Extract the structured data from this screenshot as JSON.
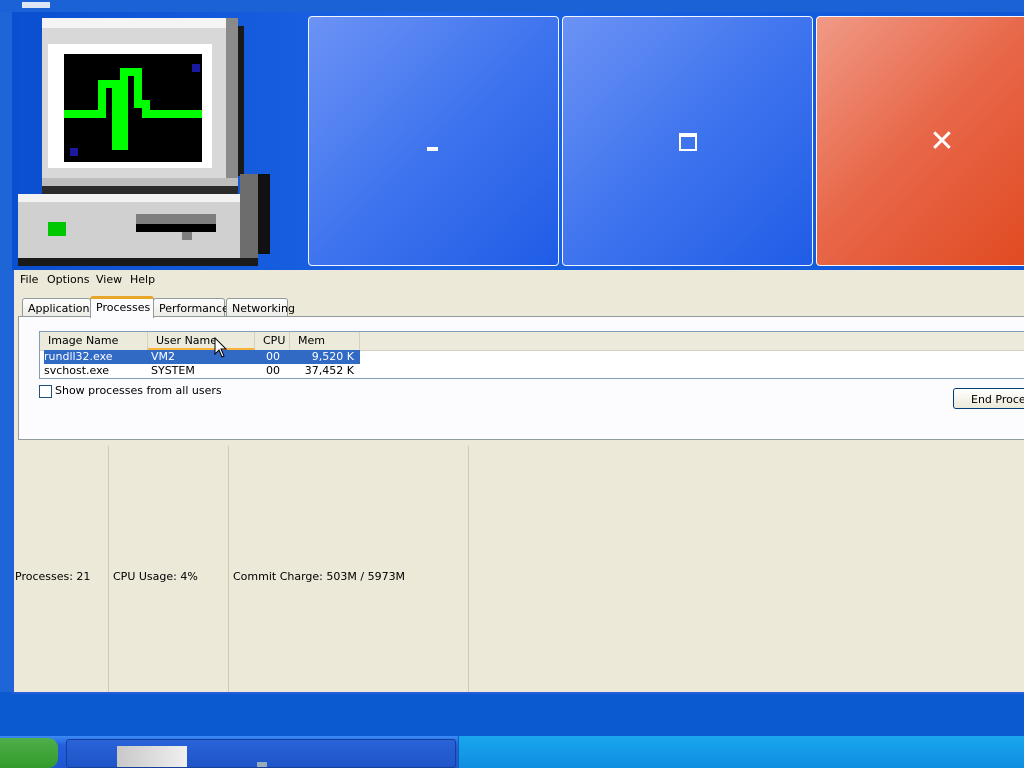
{
  "window": {
    "caption_buttons": {
      "minimize_glyph": "-",
      "maximize_glyph": "□",
      "close_glyph": "✕"
    }
  },
  "menu": [
    "File",
    "Options",
    "View",
    "Help"
  ],
  "tabs": [
    {
      "label": "Applications",
      "active": false
    },
    {
      "label": "Processes",
      "active": true
    },
    {
      "label": "Performance",
      "active": false
    },
    {
      "label": "Networking",
      "active": false
    }
  ],
  "process_table": {
    "columns": [
      "Image Name",
      "User Name",
      "CPU",
      "Mem Usage"
    ],
    "sorted_column": "User Name",
    "rows": [
      {
        "image": "rundll32.exe",
        "user": "VM2",
        "cpu": "00",
        "mem": "9,520 K",
        "selected": true
      },
      {
        "image": "svchost.exe",
        "user": "SYSTEM",
        "cpu": "00",
        "mem": "37,452 K",
        "selected": false
      }
    ]
  },
  "show_all_users": {
    "label": "Show processes from all users",
    "checked": false
  },
  "end_process_label": "End Process",
  "status": {
    "processes": "Processes: 21",
    "cpu_usage": "CPU Usage: 4%",
    "commit_charge": "Commit Charge: 503M / 5973M"
  },
  "colors": {
    "title_blue": "#0a4fd0",
    "close_red": "#e0481e",
    "selection": "#316ac5",
    "dialog_bg": "#ece9d8",
    "graph_green": "#00ff00"
  }
}
